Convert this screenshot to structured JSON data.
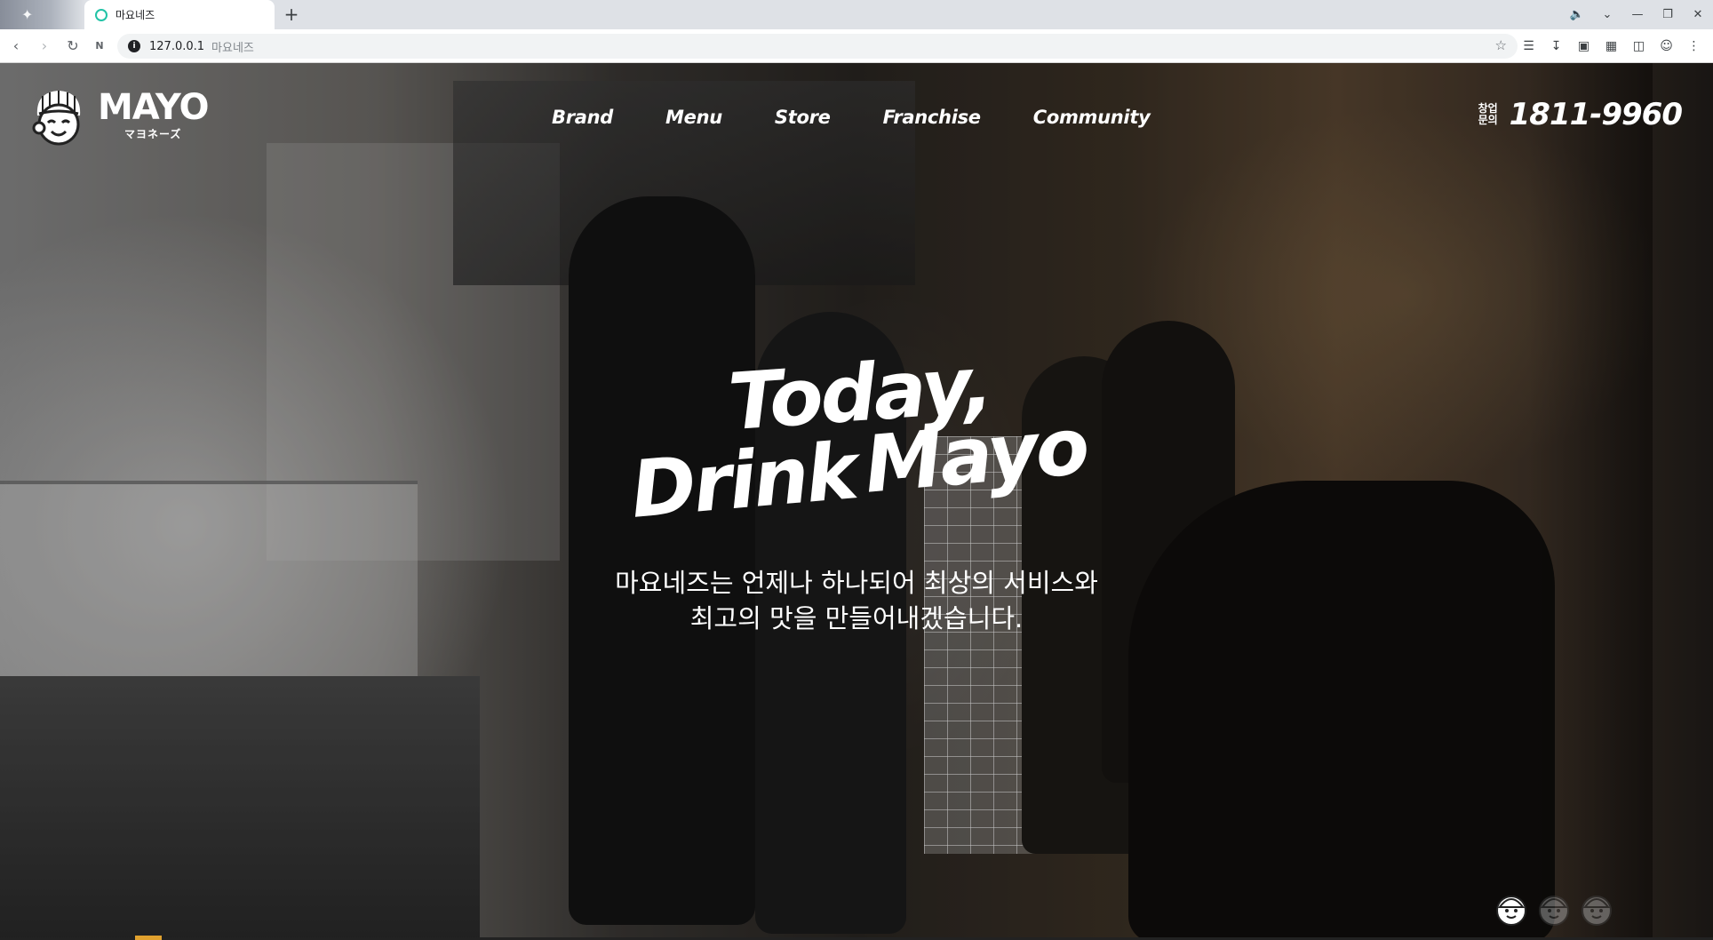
{
  "browser": {
    "tab": {
      "title": "마요네즈"
    },
    "address": {
      "host": "127.0.0.1",
      "page_title": "마요네즈"
    }
  },
  "site": {
    "logo": {
      "word": "MAYO",
      "sub": "マヨネーズ"
    },
    "nav": [
      {
        "label": "Brand"
      },
      {
        "label": "Menu"
      },
      {
        "label": "Store"
      },
      {
        "label": "Franchise"
      },
      {
        "label": "Community"
      }
    ],
    "contact": {
      "label_line1": "창업",
      "label_line2": "문의",
      "phone": "1811-9960"
    }
  },
  "hero": {
    "headline_line1": "Today,",
    "headline_line2a": "Drink",
    "headline_line2b": "Mayo",
    "subcopy_line1": "마요네즈는 언제나 하나되어 최상의 서비스와",
    "subcopy_line2": "최고의 맛을 만들어내겠습니다.",
    "slides_total": 3,
    "slide_active": 1
  },
  "icons": {
    "back": "arrow-left-icon",
    "forward": "arrow-right-icon",
    "reload": "reload-icon",
    "logo": "mayo-mascot-icon",
    "pager": "mascot-face-icon"
  },
  "colors": {
    "accent": "#ffffff",
    "favicon": "#22c3a6"
  }
}
